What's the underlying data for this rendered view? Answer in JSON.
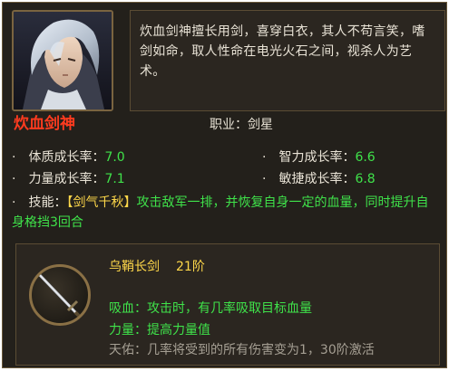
{
  "hero": {
    "name": "炊血剑神",
    "description": "炊血剑神擅长用剑，喜穿白衣，其人不苟言笑，嗜剑如命，取人性命在电光火石之间，视杀人为艺术。",
    "job_label": "职业：",
    "job_value": "剑星"
  },
  "stats": [
    {
      "label": "体质成长率：",
      "value": "7.0"
    },
    {
      "label": "智力成长率：",
      "value": "6.6"
    },
    {
      "label": "力量成长率：",
      "value": "7.1"
    },
    {
      "label": "敏捷成长率：",
      "value": "6.8"
    }
  ],
  "skill": {
    "label": "技能：",
    "name": "【剑气千秋】",
    "description": "攻击敌军一排，并恢复自身一定的血量，同时提升自身格挡3回合"
  },
  "weapon": {
    "name": "乌鞘长剑",
    "rank": "21阶",
    "attributes": [
      {
        "text": "吸血：攻击时，有几率吸取目标血量",
        "active": true
      },
      {
        "text": "力量：提高力量值",
        "active": true
      },
      {
        "text": "天佑：几率将受到的所有伤害变为1，30阶激活",
        "active": false
      }
    ]
  },
  "bullet": "·",
  "colors": {
    "panel_bg": "#23201b",
    "border": "#6b5a3c",
    "name_red": "#ff3b1f",
    "value_green": "#3fe24a",
    "skill_yellow": "#ffd84a",
    "inactive_grey": "#a59f93"
  }
}
